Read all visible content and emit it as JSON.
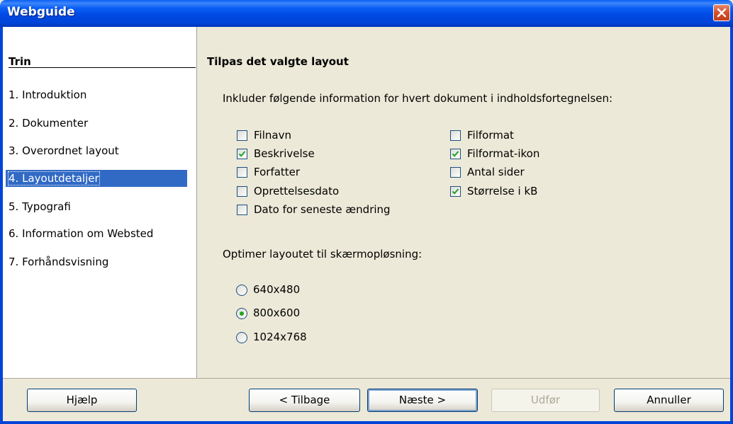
{
  "window": {
    "title": "Webguide"
  },
  "sidebar": {
    "title": "Trin",
    "steps": [
      {
        "num": "1.",
        "label": "Introduktion"
      },
      {
        "num": "2.",
        "label": "Dokumenter"
      },
      {
        "num": "3.",
        "label": "Overordnet layout"
      },
      {
        "num": "4.",
        "label": "Layoutdetaljer",
        "selected": true
      },
      {
        "num": "5.",
        "label": "Typografi"
      },
      {
        "num": "6.",
        "label": "Information om Websted"
      },
      {
        "num": "7.",
        "label": "Forhåndsvisning"
      }
    ]
  },
  "main": {
    "heading": "Tilpas det valgte layout",
    "include_label": "Inkluder følgende information for hvert dokument i indholdsfortegnelsen:",
    "left_options": [
      {
        "label": "Filnavn",
        "checked": false
      },
      {
        "label": "Beskrivelse",
        "checked": true
      },
      {
        "label": "Forfatter",
        "checked": false
      },
      {
        "label": "Oprettelsesdato",
        "checked": false
      },
      {
        "label": "Dato for seneste ændring",
        "checked": false
      }
    ],
    "right_options": [
      {
        "label": "Filformat",
        "checked": false
      },
      {
        "label": "Filformat-ikon",
        "checked": true
      },
      {
        "label": "Antal sider",
        "checked": false
      },
      {
        "label": "Størrelse i kB",
        "checked": true
      }
    ],
    "resolution_label": "Optimer layoutet til skærmopløsning:",
    "resolutions": [
      {
        "label": "640x480",
        "selected": false
      },
      {
        "label": "800x600",
        "selected": true
      },
      {
        "label": "1024x768",
        "selected": false
      }
    ]
  },
  "buttons": {
    "help": "Hjælp",
    "back": "< Tilbage",
    "next": "Næste >",
    "finish": "Udfør",
    "cancel": "Annuller"
  },
  "colors": {
    "titlebar": "#0a5ff5",
    "selection": "#316ac5",
    "check": "#21a121"
  },
  "icons": {
    "close": "close-icon",
    "check": "check-icon"
  }
}
